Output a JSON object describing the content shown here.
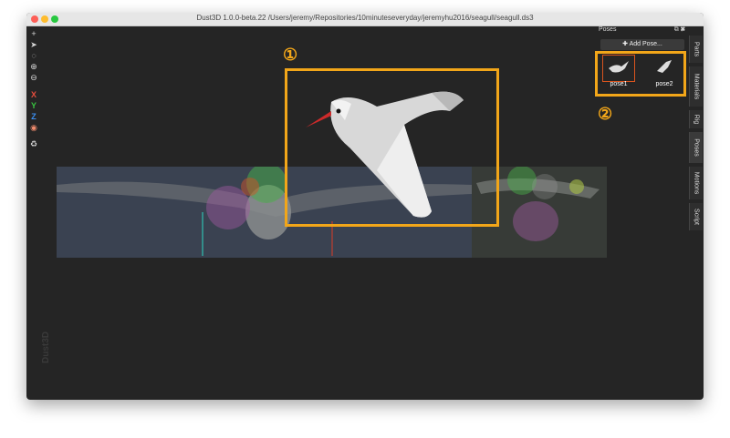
{
  "window": {
    "title": "Dust3D 1.0.0-beta.22 /Users/jeremy/Repositories/10minuteseveryday/jeremyhu2016/seagull/seagull.ds3",
    "watermark": "Dust3D"
  },
  "toolbar": {
    "tools": [
      {
        "icon": "add-icon",
        "glyph": "+"
      },
      {
        "icon": "pointer-icon",
        "glyph": "➤"
      },
      {
        "icon": "lasso-icon",
        "glyph": "◌"
      },
      {
        "icon": "zoom-in-icon",
        "glyph": "⊕"
      },
      {
        "icon": "zoom-out-icon",
        "glyph": "⊖"
      },
      {
        "icon": "x-axis-icon",
        "glyph": "X",
        "color": "#e84d3d"
      },
      {
        "icon": "y-axis-icon",
        "glyph": "Y",
        "color": "#39c441"
      },
      {
        "icon": "z-axis-icon",
        "glyph": "Z",
        "color": "#3b8ef0"
      },
      {
        "icon": "radius-icon",
        "glyph": "◉",
        "color": "#f08c6e"
      },
      {
        "icon": "regenerate-icon",
        "glyph": "♻"
      }
    ]
  },
  "callouts": {
    "one": "①",
    "two": "②"
  },
  "poses_panel": {
    "title": "Poses",
    "add_button": "Add Pose...",
    "add_icon_glyph": "✚",
    "poses": [
      {
        "label": "pose1",
        "selected": true
      },
      {
        "label": "pose2",
        "selected": false
      }
    ]
  },
  "side_tabs": [
    "Parts",
    "Materials",
    "Rig",
    "Poses",
    "Motions",
    "Script"
  ],
  "colors": {
    "accent": "#f2a619",
    "selected_pose_border": "#d9541e",
    "background": "#252525"
  }
}
